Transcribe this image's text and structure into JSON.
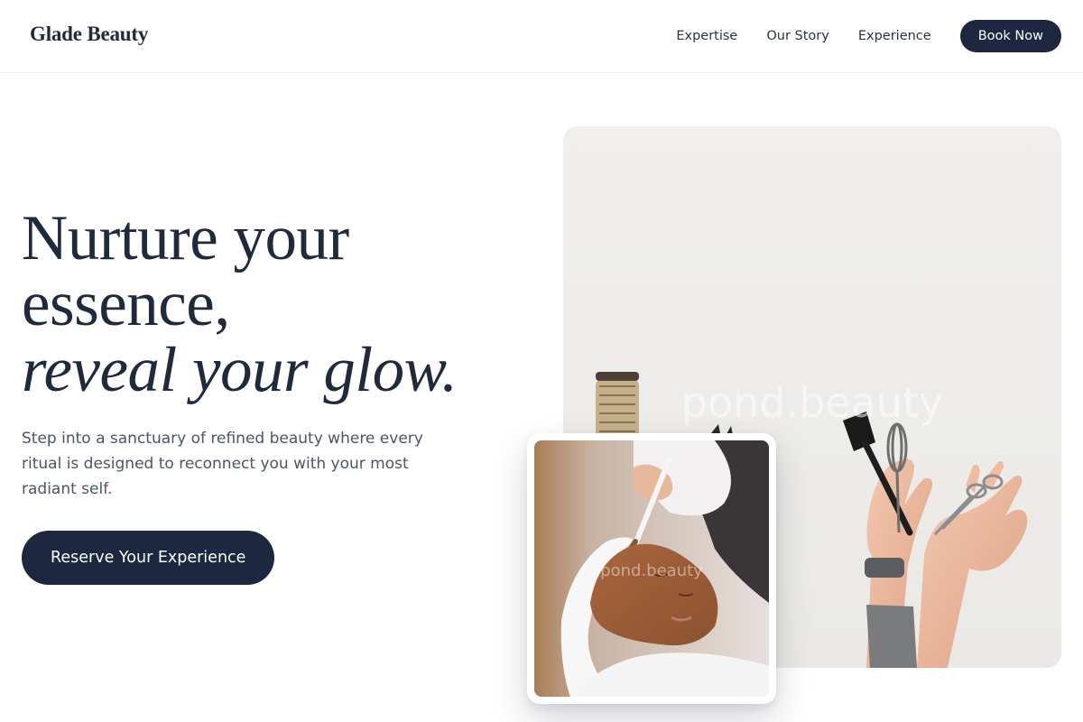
{
  "header": {
    "brand": "Glade Beauty",
    "nav": [
      {
        "label": "Expertise"
      },
      {
        "label": "Our Story"
      },
      {
        "label": "Experience"
      }
    ],
    "cta_label": "Book Now"
  },
  "hero": {
    "headline_line1": "Nurture your",
    "headline_line2": "essence,",
    "headline_line3": "reveal your glow.",
    "subtext": "Step into a sanctuary of refined beauty where every ritual is designed to reconnect you with your most radiant self.",
    "cta_label": "Reserve Your Experience",
    "main_image_watermark": "pond.beauty",
    "inset_image_watermark": "pond.beauty"
  },
  "colors": {
    "primary": "#1d2840",
    "heading": "#1f2a3d",
    "body_text": "#4b5566",
    "background": "#ffffff"
  }
}
